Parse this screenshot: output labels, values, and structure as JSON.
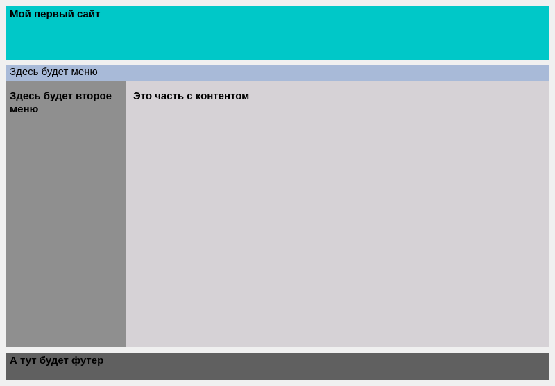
{
  "header": {
    "title": "Мой первый сайт"
  },
  "menu": {
    "label": "Здесь будет меню"
  },
  "sidebar": {
    "label": "Здесь будет второе меню"
  },
  "content": {
    "text": "Это часть с контентом"
  },
  "footer": {
    "text": "А тут будет футер"
  }
}
